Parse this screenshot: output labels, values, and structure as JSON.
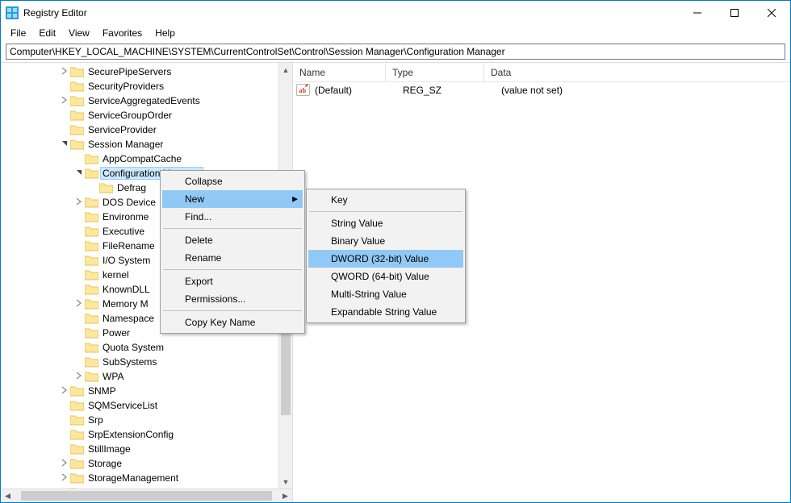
{
  "title": "Registry Editor",
  "menubar": [
    "File",
    "Edit",
    "View",
    "Favorites",
    "Help"
  ],
  "address": "Computer\\HKEY_LOCAL_MACHINE\\SYSTEM\\CurrentControlSet\\Control\\Session Manager\\Configuration Manager",
  "tree": [
    {
      "indent": 4,
      "toggle": ">",
      "label": "SecurePipeServers"
    },
    {
      "indent": 4,
      "toggle": "",
      "label": "SecurityProviders"
    },
    {
      "indent": 4,
      "toggle": ">",
      "label": "ServiceAggregatedEvents"
    },
    {
      "indent": 4,
      "toggle": "",
      "label": "ServiceGroupOrder"
    },
    {
      "indent": 4,
      "toggle": "",
      "label": "ServiceProvider"
    },
    {
      "indent": 4,
      "toggle": "v",
      "label": "Session Manager"
    },
    {
      "indent": 5,
      "toggle": "",
      "label": "AppCompatCache"
    },
    {
      "indent": 5,
      "toggle": "v",
      "label": "Configuration Manager",
      "selected": true
    },
    {
      "indent": 6,
      "toggle": "",
      "label": "Defrag"
    },
    {
      "indent": 5,
      "toggle": ">",
      "label": "DOS Device"
    },
    {
      "indent": 5,
      "toggle": "",
      "label": "Environme"
    },
    {
      "indent": 5,
      "toggle": "",
      "label": "Executive"
    },
    {
      "indent": 5,
      "toggle": "",
      "label": "FileRename"
    },
    {
      "indent": 5,
      "toggle": "",
      "label": "I/O System"
    },
    {
      "indent": 5,
      "toggle": "",
      "label": "kernel"
    },
    {
      "indent": 5,
      "toggle": "",
      "label": "KnownDLL"
    },
    {
      "indent": 5,
      "toggle": ">",
      "label": "Memory M"
    },
    {
      "indent": 5,
      "toggle": "",
      "label": "Namespace"
    },
    {
      "indent": 5,
      "toggle": "",
      "label": "Power"
    },
    {
      "indent": 5,
      "toggle": "",
      "label": "Quota System"
    },
    {
      "indent": 5,
      "toggle": "",
      "label": "SubSystems"
    },
    {
      "indent": 5,
      "toggle": ">",
      "label": "WPA"
    },
    {
      "indent": 4,
      "toggle": ">",
      "label": "SNMP"
    },
    {
      "indent": 4,
      "toggle": "",
      "label": "SQMServiceList"
    },
    {
      "indent": 4,
      "toggle": "",
      "label": "Srp"
    },
    {
      "indent": 4,
      "toggle": "",
      "label": "SrpExtensionConfig"
    },
    {
      "indent": 4,
      "toggle": "",
      "label": "StillImage"
    },
    {
      "indent": 4,
      "toggle": ">",
      "label": "Storage"
    },
    {
      "indent": 4,
      "toggle": ">",
      "label": "StorageManagement"
    },
    {
      "indent": 4,
      "toggle": "",
      "label": "StorPort"
    }
  ],
  "list": {
    "columns": {
      "name": "Name",
      "type": "Type",
      "data": "Data"
    },
    "rows": [
      {
        "name": "(Default)",
        "type": "REG_SZ",
        "data": "(value not set)"
      }
    ]
  },
  "context_menu": {
    "items": [
      {
        "label": "Collapse"
      },
      {
        "label": "New",
        "submenu": true,
        "hover": true
      },
      {
        "label": "Find..."
      },
      {
        "sep": true
      },
      {
        "label": "Delete"
      },
      {
        "label": "Rename"
      },
      {
        "sep": true
      },
      {
        "label": "Export"
      },
      {
        "label": "Permissions..."
      },
      {
        "sep": true
      },
      {
        "label": "Copy Key Name"
      }
    ]
  },
  "submenu_new": {
    "items": [
      {
        "label": "Key"
      },
      {
        "sep": true
      },
      {
        "label": "String Value"
      },
      {
        "label": "Binary Value"
      },
      {
        "label": "DWORD (32-bit) Value",
        "hover": true
      },
      {
        "label": "QWORD (64-bit) Value"
      },
      {
        "label": "Multi-String Value"
      },
      {
        "label": "Expandable String Value"
      }
    ]
  }
}
